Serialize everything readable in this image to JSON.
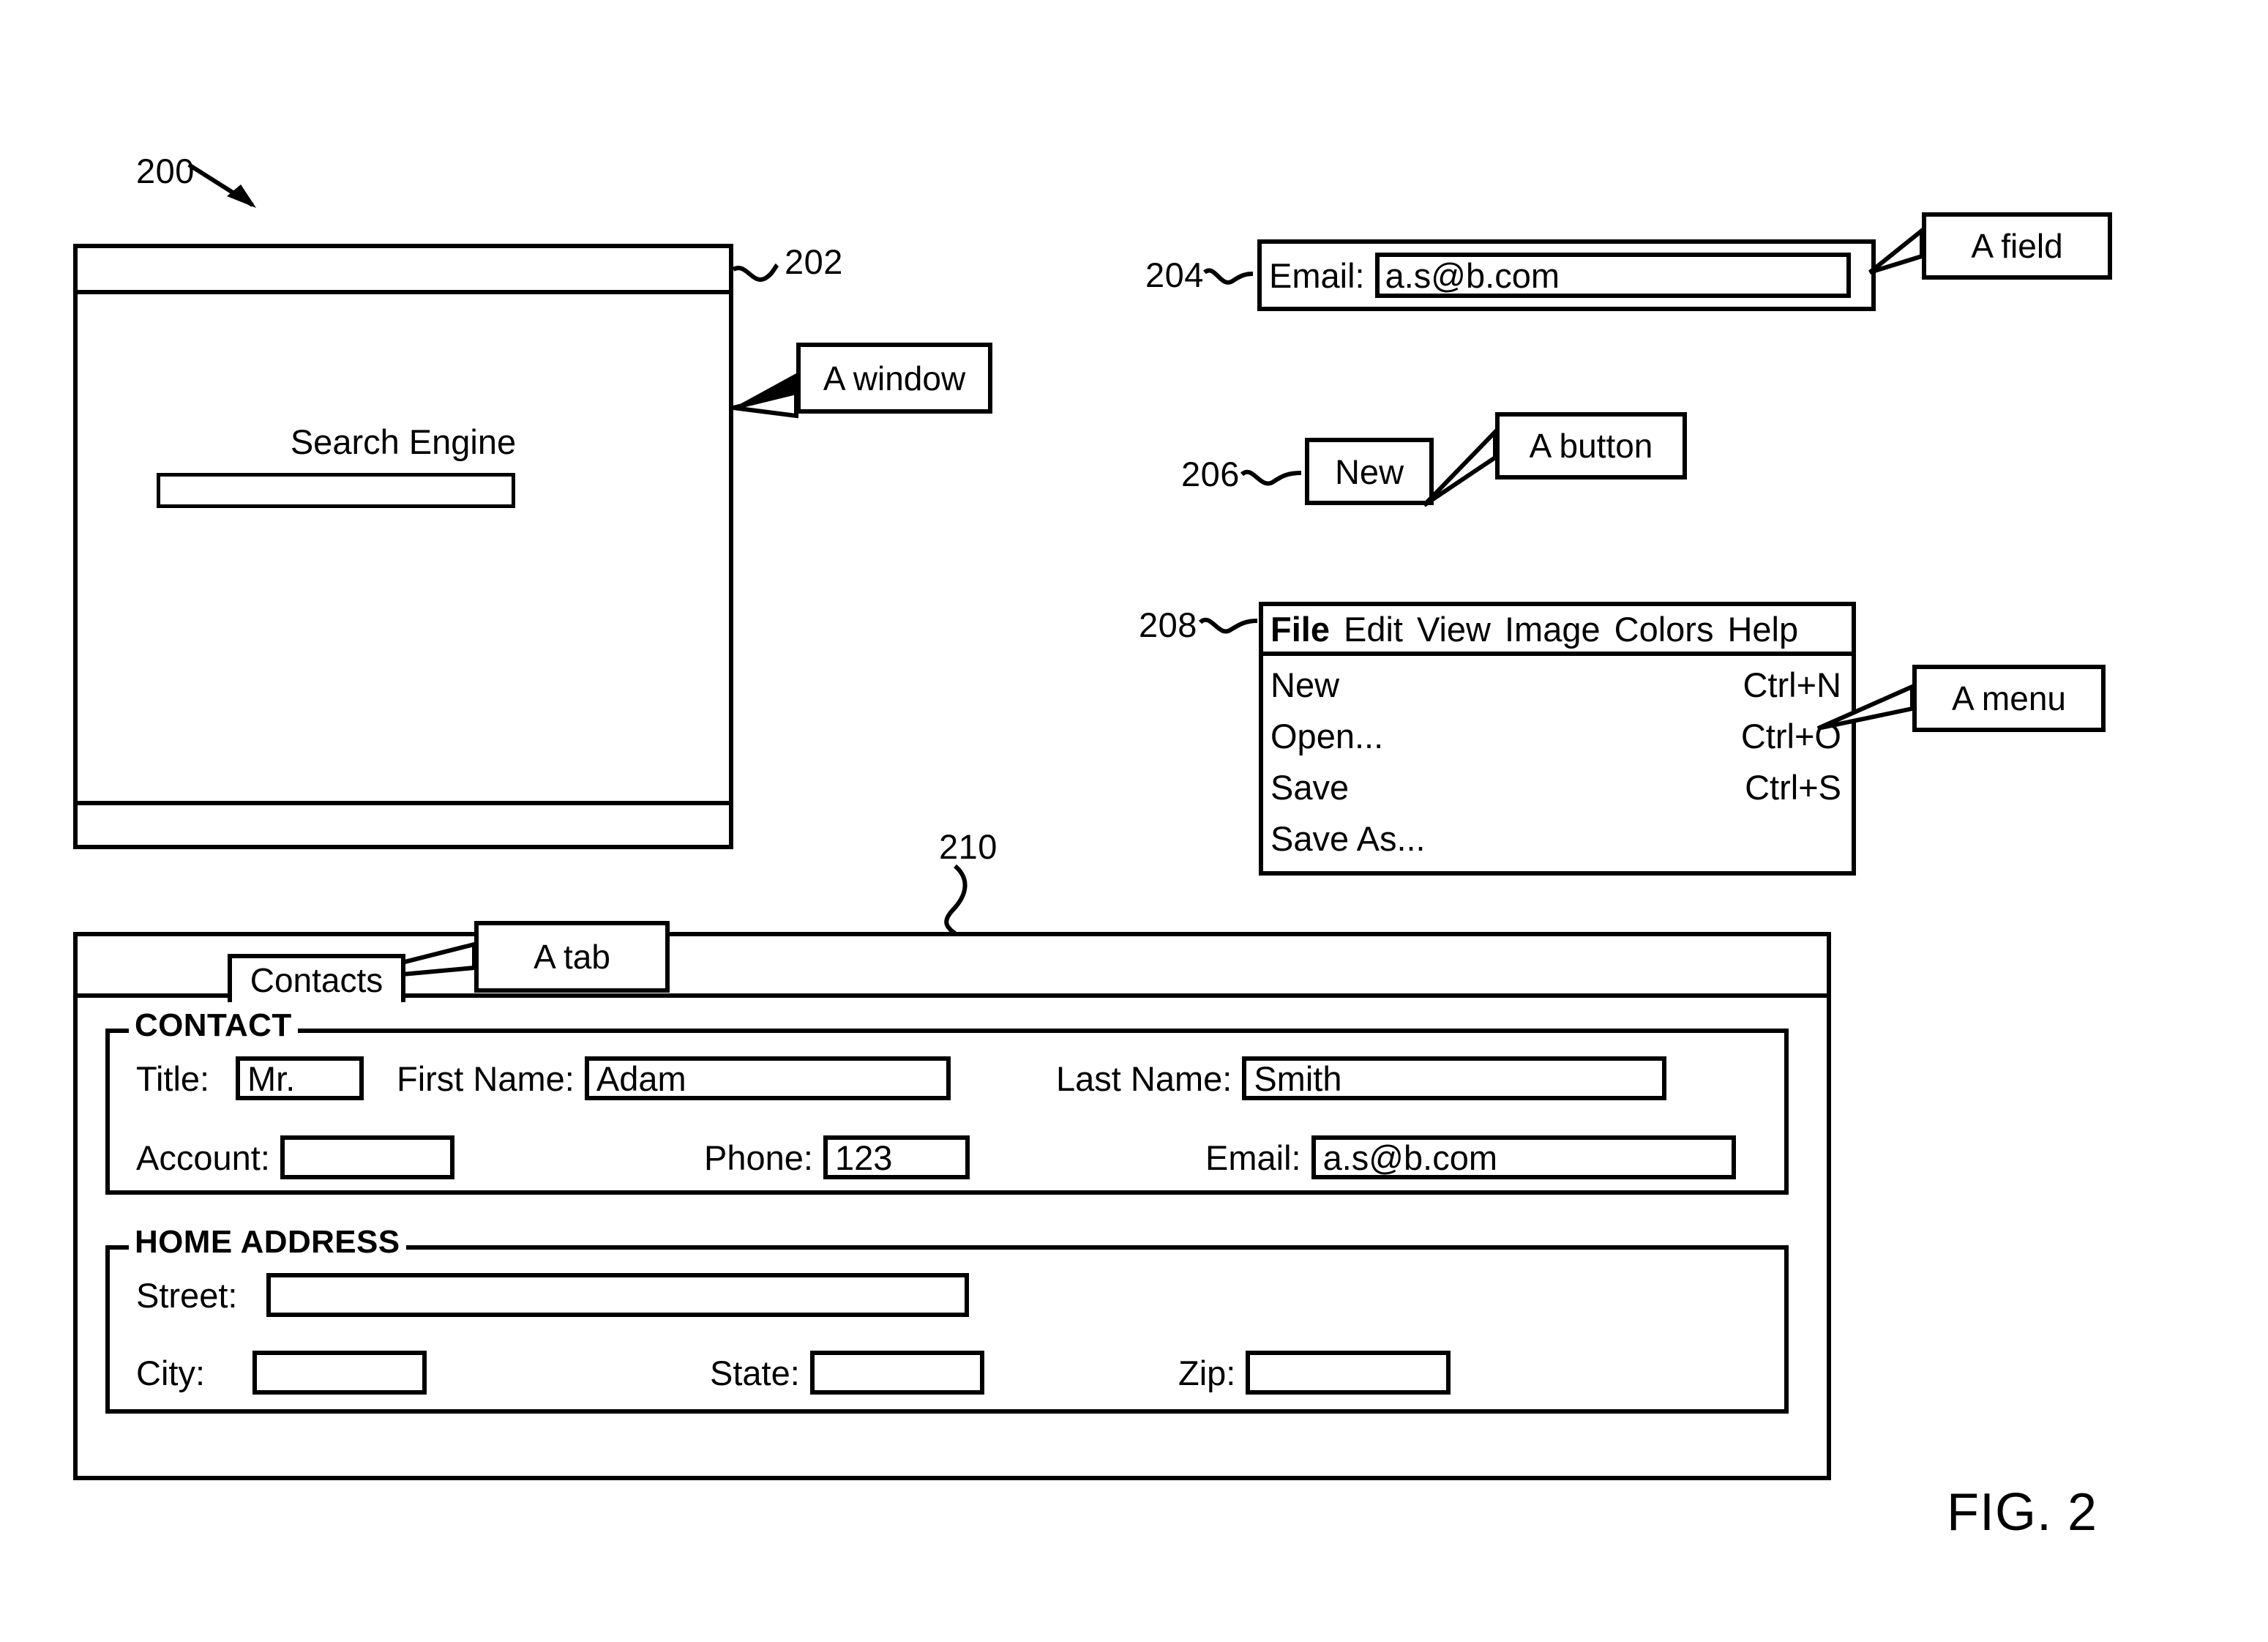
{
  "figure": {
    "caption": "FIG. 2",
    "reference_numerals": {
      "overview": "200",
      "window": "202",
      "field": "204",
      "button": "206",
      "menu": "208",
      "tab_panel": "210"
    }
  },
  "callouts": {
    "window": "A window",
    "field": "A field",
    "button": "A button",
    "menu": "A menu",
    "tab": "A tab"
  },
  "window": {
    "title_bar_text": "",
    "heading": "Search Engine",
    "search_input_value": "",
    "status_bar_text": ""
  },
  "field_widget": {
    "label": "Email:",
    "value": "a.s@b.com"
  },
  "button_widget": {
    "label": "New"
  },
  "menu_widget": {
    "menubar": [
      {
        "label": "File",
        "bold": true
      },
      {
        "label": "Edit",
        "bold": false
      },
      {
        "label": "View",
        "bold": false
      },
      {
        "label": "Image",
        "bold": false
      },
      {
        "label": "Colors",
        "bold": false
      },
      {
        "label": "Help",
        "bold": false
      }
    ],
    "dropdown": [
      {
        "label": "New",
        "accelerator": "Ctrl+N"
      },
      {
        "label": "Open...",
        "accelerator": "Ctrl+O"
      },
      {
        "label": "Save",
        "accelerator": "Ctrl+S"
      },
      {
        "label": "Save As...",
        "accelerator": ""
      }
    ]
  },
  "tab_panel": {
    "tabs": [
      {
        "label": "Contacts",
        "selected": true
      }
    ],
    "groups": [
      {
        "legend": "CONTACT",
        "fields": [
          {
            "label": "Title:",
            "value": "Mr."
          },
          {
            "label": "First Name:",
            "value": "Adam"
          },
          {
            "label": "Last Name:",
            "value": "Smith"
          },
          {
            "label": "Account:",
            "value": ""
          },
          {
            "label": "Phone:",
            "value": "123"
          },
          {
            "label": "Email:",
            "value": "a.s@b.com"
          }
        ]
      },
      {
        "legend": "HOME ADDRESS",
        "fields": [
          {
            "label": "Street:",
            "value": ""
          },
          {
            "label": "City:",
            "value": ""
          },
          {
            "label": "State:",
            "value": ""
          },
          {
            "label": "Zip:",
            "value": ""
          }
        ]
      }
    ]
  },
  "colors": {
    "ink": "#000000",
    "paper": "#ffffff"
  }
}
